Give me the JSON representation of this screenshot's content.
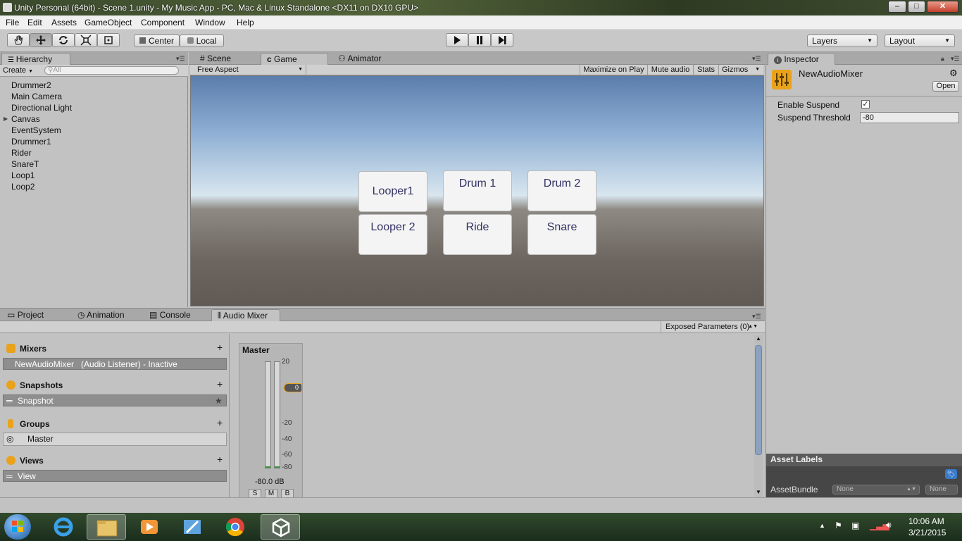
{
  "window": {
    "title": "Unity Personal (64bit) - Scene 1.unity - My Music App - PC, Mac & Linux Standalone <DX11 on DX10 GPU>",
    "buttons": {
      "minimize": "–",
      "maximize": "□",
      "close": "✕"
    }
  },
  "menu": [
    "File",
    "Edit",
    "Assets",
    "GameObject",
    "Component",
    "Window",
    "Help"
  ],
  "toolbar": {
    "tools": [
      "hand-icon",
      "move-icon",
      "rotate-icon",
      "scale-icon",
      "rect-icon"
    ],
    "pivot": "Center",
    "space": "Local",
    "layers": "Layers",
    "layout": "Layout"
  },
  "hierarchy": {
    "tab": "Hierarchy",
    "create": "Create",
    "search_placeholder": "All",
    "items": [
      "Drummer2",
      "Main Camera",
      "Directional Light",
      "Canvas",
      "EventSystem",
      "Drummer1",
      "Rider",
      "SnareT",
      "Loop1",
      "Loop2"
    ]
  },
  "center_tabs": [
    "Scene",
    "Game",
    "Animator"
  ],
  "game": {
    "aspect": "Free Aspect",
    "options": [
      "Maximize on Play",
      "Mute audio",
      "Stats",
      "Gizmos"
    ],
    "buttons": [
      "Looper1",
      "Drum 1",
      "Drum 2",
      "Looper 2",
      "Ride",
      "Snare"
    ]
  },
  "bottom_tabs": [
    "Project",
    "Animation",
    "Console",
    "Audio Mixer"
  ],
  "audio_mixer": {
    "exposed_parameters": "Exposed Parameters (0)",
    "mixers_label": "Mixers",
    "mixer_name": "NewAudioMixer",
    "mixer_status": "(Audio Listener) - Inactive",
    "snapshots_label": "Snapshots",
    "snapshot_name": "Snapshot",
    "groups_label": "Groups",
    "group_name": "Master",
    "views_label": "Views",
    "view_name": "View",
    "strip": {
      "name": "Master",
      "scale": [
        "20",
        "-20",
        "-40",
        "-60",
        "-80"
      ],
      "fader_value": "0",
      "db": "-80.0 dB",
      "buttons": [
        "S",
        "M",
        "B"
      ]
    }
  },
  "inspector": {
    "tab": "Inspector",
    "object_name": "NewAudioMixer",
    "open_button": "Open",
    "enable_suspend_label": "Enable Suspend",
    "enable_suspend_checked": true,
    "suspend_threshold_label": "Suspend Threshold",
    "suspend_threshold_value": "-80",
    "asset_labels": "Asset Labels",
    "asset_bundle_label": "AssetBundle",
    "asset_bundle_value": "None",
    "asset_bundle_variant": "None"
  },
  "taskbar": {
    "apps": [
      "start-orb-icon",
      "internet-explorer-icon",
      "file-explorer-icon",
      "media-player-icon",
      "paint-icon",
      "chrome-icon",
      "unity-icon"
    ],
    "time": "10:06 AM",
    "date": "3/21/2015"
  }
}
